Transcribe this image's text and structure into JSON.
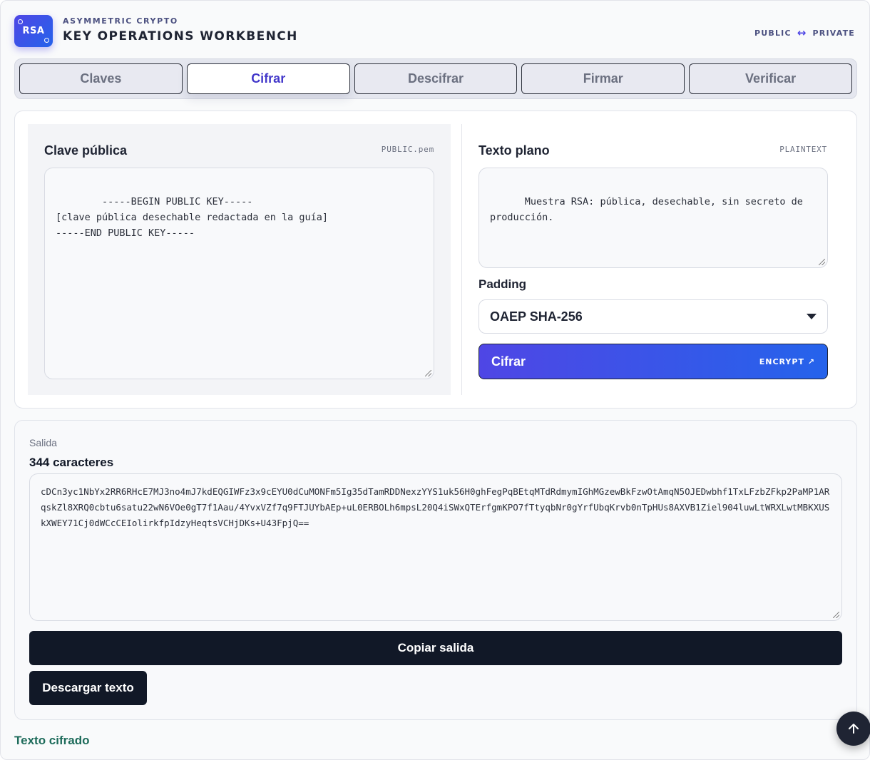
{
  "header": {
    "logo_text": "RSA",
    "eyebrow": "ASYMMETRIC CRYPTO",
    "title": "KEY OPERATIONS WORKBENCH",
    "keypair_left": "PUBLIC",
    "keypair_arrow": "↔",
    "keypair_right": "PRIVATE"
  },
  "tabs": [
    {
      "label": "Claves",
      "active": false
    },
    {
      "label": "Cifrar",
      "active": true
    },
    {
      "label": "Descifrar",
      "active": false
    },
    {
      "label": "Firmar",
      "active": false
    },
    {
      "label": "Verificar",
      "active": false
    }
  ],
  "encrypt": {
    "public_key_label": "Clave pública",
    "public_key_tag": "PUBLIC.pem",
    "public_key_value": "-----BEGIN PUBLIC KEY-----\n[clave pública desechable redactada en la guía]\n-----END PUBLIC KEY-----",
    "plaintext_label": "Texto plano",
    "plaintext_tag": "PLAINTEXT",
    "plaintext_value": "Muestra RSA: pública, desechable, sin secreto de producción.",
    "padding_label": "Padding",
    "padding_selected": "OAEP SHA-256",
    "submit_label": "Cifrar",
    "submit_tag": "ENCRYPT ↗"
  },
  "output": {
    "caption": "Salida",
    "count": "344 caracteres",
    "value": "cDCn3yc1NbYx2RR6RHcE7MJ3no4mJ7kdEQGIWFz3x9cEYU0dCuMONFm5Ig35dTamRDDNexzYYS1uk56H0ghFegPqBEtqMTdRdmymIGhMGzewBkFzwOtAmqN5OJEDwbhf1TxLFzbZFkp2PaMP1ARqskZl8XRQ0cbtu6satu22wN6VOe0gT7f1Aau/4YvxVZf7q9FTJUYbAEp+uL0ERBOLh6mpsL20Q4iSWxQTErfgmKPO7fTtyqbNr0gYrfUbqKrvb0nTpHUs8AXVB1Ziel904luwLtWRXLwtMBKXUSkXWEY71Cj0dWCcCEIolirkfpIdzyHeqtsVCHjDKs+U43FpjQ==",
    "copy_label": "Copiar salida",
    "download_label": "Descargar texto"
  },
  "footer": {
    "label": "Texto cifrado"
  },
  "colors": {
    "accent": "#4f46e5",
    "accent_2": "#2563eb",
    "dark": "#111827",
    "footer_text": "#1d6b5a"
  }
}
